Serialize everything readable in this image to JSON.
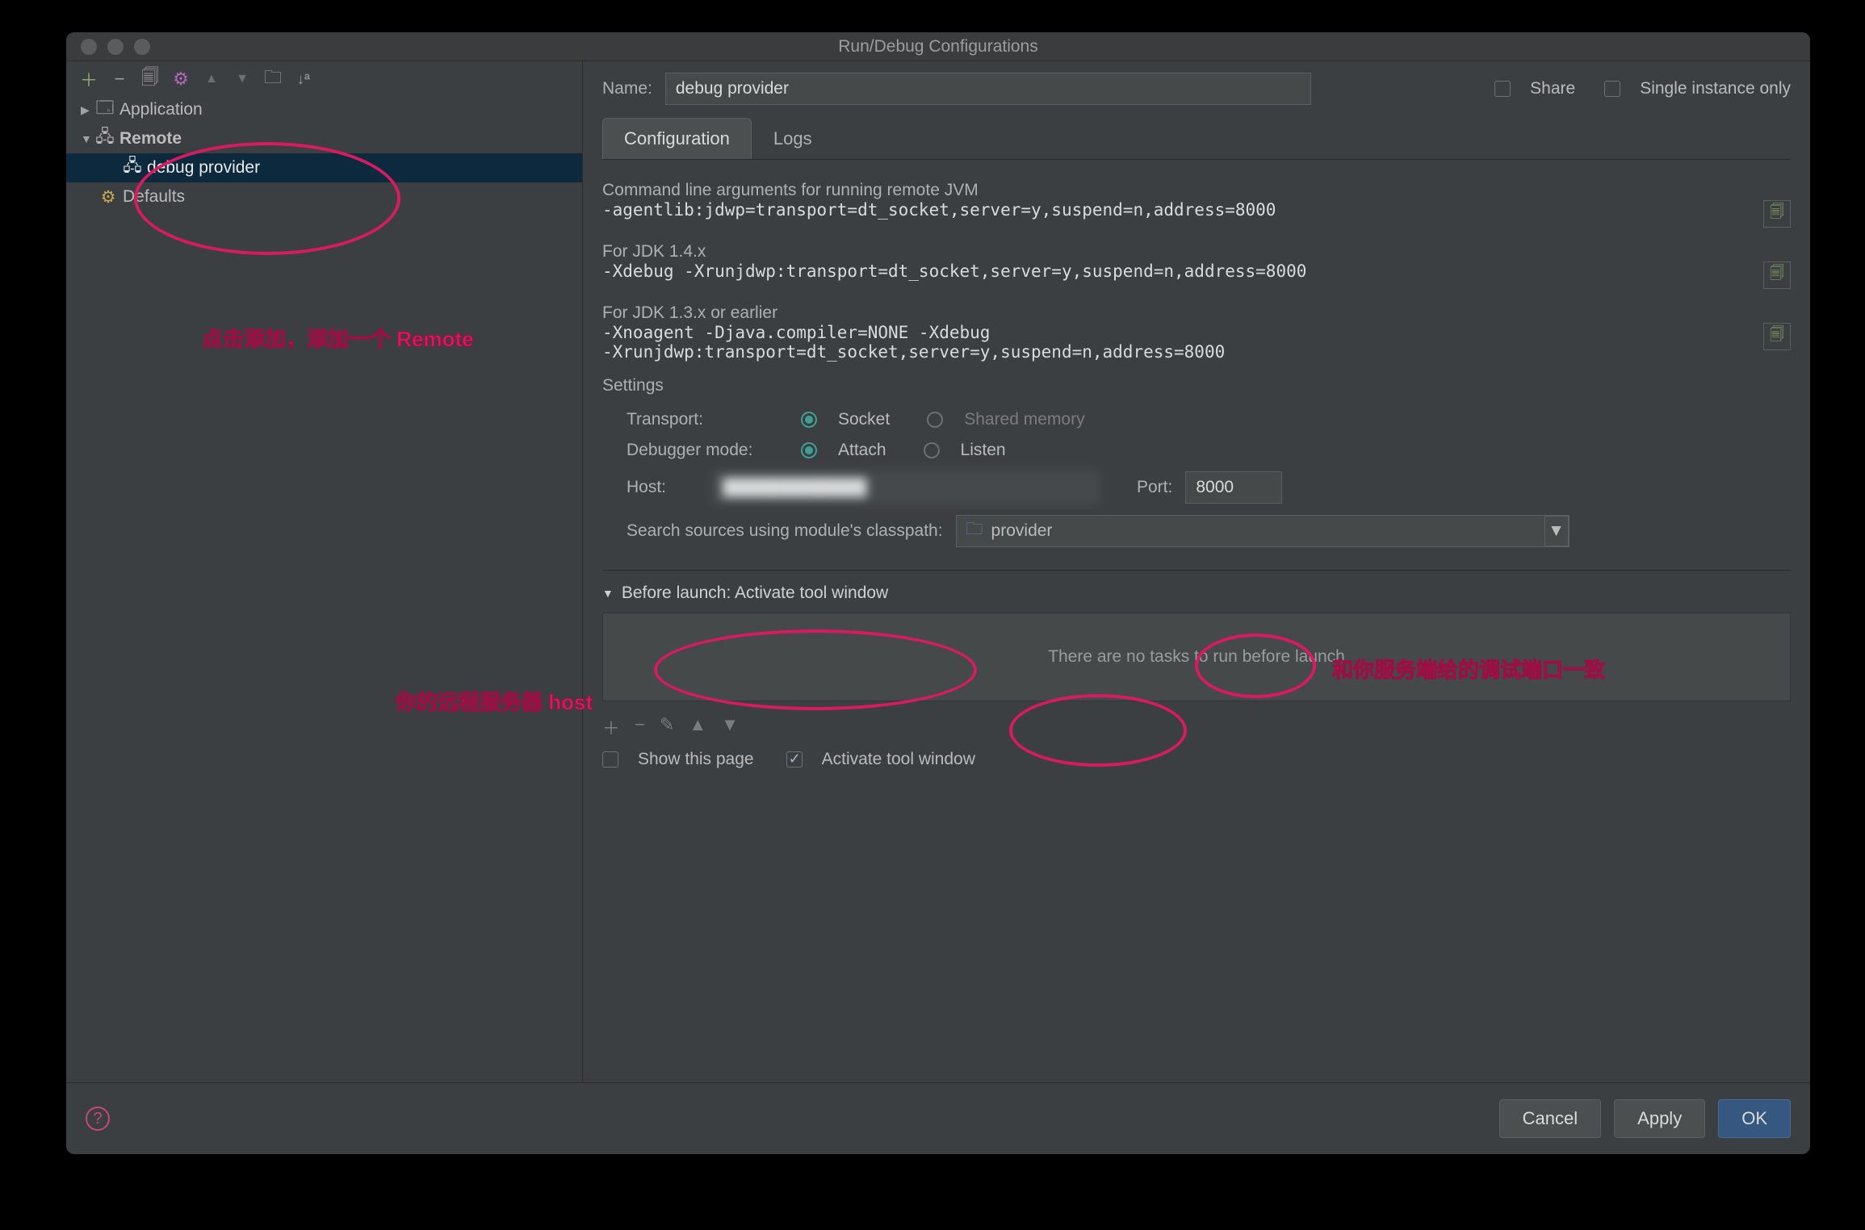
{
  "window": {
    "title": "Run/Debug Configurations"
  },
  "tree": {
    "application": "Application",
    "remote": "Remote",
    "debug_provider": "debug provider",
    "defaults": "Defaults"
  },
  "name": {
    "label": "Name:",
    "value": "debug provider"
  },
  "share": {
    "label": "Share"
  },
  "single": {
    "label": "Single instance only"
  },
  "tabs": {
    "config": "Configuration",
    "logs": "Logs"
  },
  "cmd": {
    "title": "Command line arguments for running remote JVM",
    "args": "-agentlib:jdwp=transport=dt_socket,server=y,suspend=n,address=8000",
    "jdk14_title": "For JDK 1.4.x",
    "jdk14_args": "-Xdebug -Xrunjdwp:transport=dt_socket,server=y,suspend=n,address=8000",
    "jdk13_title": "For JDK 1.3.x or earlier",
    "jdk13_args1": "-Xnoagent -Djava.compiler=NONE -Xdebug",
    "jdk13_args2": "-Xrunjdwp:transport=dt_socket,server=y,suspend=n,address=8000"
  },
  "settings": {
    "title": "Settings",
    "transport_label": "Transport:",
    "socket": "Socket",
    "shared": "Shared memory",
    "debugger_label": "Debugger mode:",
    "attach": "Attach",
    "listen": "Listen",
    "host_label": "Host:",
    "host_value": "████████████",
    "port_label": "Port:",
    "port_value": "8000",
    "classpath_label": "Search sources using module's classpath:",
    "classpath_value": "provider"
  },
  "before": {
    "title": "Before launch: Activate tool window",
    "empty": "There are no tasks to run before launch",
    "show_page": "Show this page",
    "activate": "Activate tool window"
  },
  "buttons": {
    "cancel": "Cancel",
    "apply": "Apply",
    "ok": "OK"
  },
  "annotations": {
    "add_remote": "点击添加，添加一个 Remote",
    "host_note": "你的远程服务器 host",
    "port_note": "和你服务端给的调试端口一致"
  }
}
